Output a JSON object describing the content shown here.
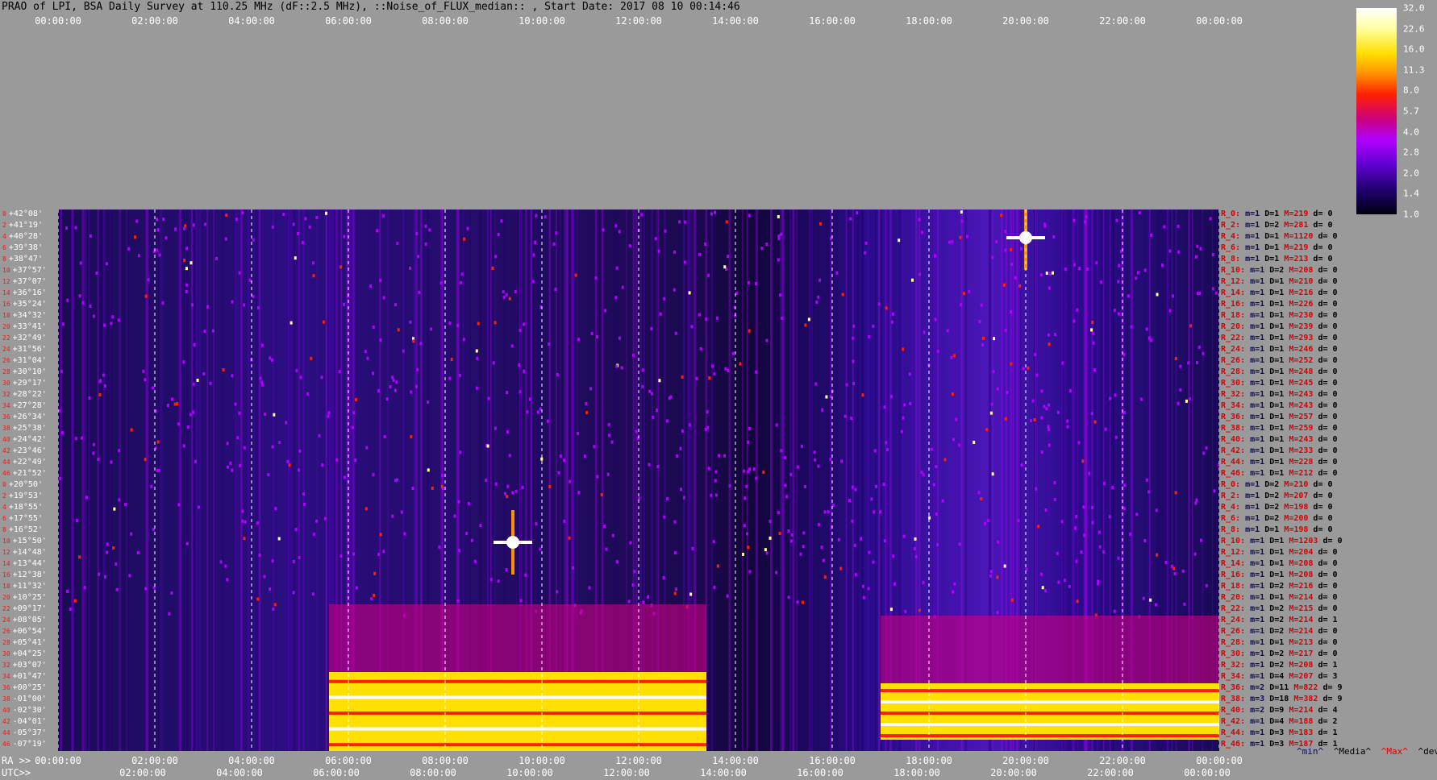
{
  "title": "PRAO of LPI, BSA Daily Survey at 110.25 MHz (dF::2.5 MHz), ::Noise_of_FLUX_median:: , Start Date: 2017 08 10 00:14:46",
  "chart_data": {
    "type": "heatmap",
    "x_axis_ticks_top": [
      "00:00:00",
      "02:00:00",
      "04:00:00",
      "06:00:00",
      "08:00:00",
      "10:00:00",
      "12:00:00",
      "14:00:00",
      "16:00:00",
      "18:00:00",
      "20:00:00",
      "22:00:00",
      "00:00:00"
    ],
    "x_axis_prefix_ra": "RA >>",
    "x_axis_ticks_bottom": [
      "00:00:00",
      "02:00:00",
      "04:00:00",
      "06:00:00",
      "08:00:00",
      "10:00:00",
      "12:00:00",
      "14:00:00",
      "16:00:00",
      "18:00:00",
      "20:00:00",
      "22:00:00",
      "00:00:00"
    ],
    "x_axis_prefix_utc": "UTC>>",
    "x_axis_ticks_utc": [
      "02:00:00",
      "04:00:00",
      "06:00:00",
      "08:00:00",
      "10:00:00",
      "12:00:00",
      "14:00:00",
      "16:00:00",
      "18:00:00",
      "20:00:00",
      "22:00:00",
      "00:00:00"
    ],
    "declinations": [
      "+42°08'",
      "+41°19'",
      "+40°28'",
      "+39°38'",
      "+38°47'",
      "+37°57'",
      "+37°07'",
      "+36°16'",
      "+35°24'",
      "+34°32'",
      "+33°41'",
      "+32°49'",
      "+31°56'",
      "+31°04'",
      "+30°10'",
      "+29°17'",
      "+28°22'",
      "+27°28'",
      "+26°34'",
      "+25°38'",
      "+24°42'",
      "+23°46'",
      "+22°49'",
      "+21°52'",
      "+20°50'",
      "+19°53'",
      "+18°55'",
      "+17°55'",
      "+16°52'",
      "+15°50'",
      "+14°48'",
      "+13°44'",
      "+12°38'",
      "+11°32'",
      "+10°25'",
      "+09°17'",
      "+08°05'",
      "+06°54'",
      "+05°41'",
      "+04°25'",
      "+03°07'",
      "+01°47'",
      "+00°25'",
      "-01°00'",
      "-02°30'",
      "-04°01'",
      "-05°37'",
      "-07°19'"
    ],
    "row_indices": [
      "0",
      "2",
      "4",
      "6",
      "8",
      "10",
      "12",
      "14",
      "16",
      "18",
      "20",
      "22",
      "24",
      "26",
      "28",
      "30",
      "32",
      "34",
      "36",
      "38",
      "40",
      "42",
      "44",
      "46",
      "0",
      "2",
      "4",
      "6",
      "8",
      "10",
      "12",
      "14",
      "16",
      "18",
      "20",
      "22",
      "24",
      "26",
      "28",
      "30",
      "32",
      "34",
      "36",
      "38",
      "40",
      "42",
      "44",
      "46"
    ],
    "row_stats": [
      {
        "r": "R_0:",
        "m": "m=1",
        "d": "D=1",
        "mx": "M=219",
        "dv": "d= 0"
      },
      {
        "r": "R_2:",
        "m": "m=1",
        "d": "D=2",
        "mx": "M=281",
        "dv": "d= 0"
      },
      {
        "r": "R_4:",
        "m": "m=1",
        "d": "D=1",
        "mx": "M=1120",
        "dv": "d= 0"
      },
      {
        "r": "R_6:",
        "m": "m=1",
        "d": "D=1",
        "mx": "M=219",
        "dv": "d= 0"
      },
      {
        "r": "R_8:",
        "m": "m=1",
        "d": "D=1",
        "mx": "M=213",
        "dv": "d= 0"
      },
      {
        "r": "R_10:",
        "m": "m=1",
        "d": "D=2",
        "mx": "M=208",
        "dv": "d= 0"
      },
      {
        "r": "R_12:",
        "m": "m=1",
        "d": "D=1",
        "mx": "M=210",
        "dv": "d= 0"
      },
      {
        "r": "R_14:",
        "m": "m=1",
        "d": "D=1",
        "mx": "M=216",
        "dv": "d= 0"
      },
      {
        "r": "R_16:",
        "m": "m=1",
        "d": "D=1",
        "mx": "M=226",
        "dv": "d= 0"
      },
      {
        "r": "R_18:",
        "m": "m=1",
        "d": "D=1",
        "mx": "M=230",
        "dv": "d= 0"
      },
      {
        "r": "R_20:",
        "m": "m=1",
        "d": "D=1",
        "mx": "M=239",
        "dv": "d= 0"
      },
      {
        "r": "R_22:",
        "m": "m=1",
        "d": "D=1",
        "mx": "M=293",
        "dv": "d= 0"
      },
      {
        "r": "R_24:",
        "m": "m=1",
        "d": "D=1",
        "mx": "M=246",
        "dv": "d= 0"
      },
      {
        "r": "R_26:",
        "m": "m=1",
        "d": "D=1",
        "mx": "M=252",
        "dv": "d= 0"
      },
      {
        "r": "R_28:",
        "m": "m=1",
        "d": "D=1",
        "mx": "M=248",
        "dv": "d= 0"
      },
      {
        "r": "R_30:",
        "m": "m=1",
        "d": "D=1",
        "mx": "M=245",
        "dv": "d= 0"
      },
      {
        "r": "R_32:",
        "m": "m=1",
        "d": "D=1",
        "mx": "M=243",
        "dv": "d= 0"
      },
      {
        "r": "R_34:",
        "m": "m=1",
        "d": "D=1",
        "mx": "M=243",
        "dv": "d= 0"
      },
      {
        "r": "R_36:",
        "m": "m=1",
        "d": "D=1",
        "mx": "M=257",
        "dv": "d= 0"
      },
      {
        "r": "R_38:",
        "m": "m=1",
        "d": "D=1",
        "mx": "M=259",
        "dv": "d= 0"
      },
      {
        "r": "R_40:",
        "m": "m=1",
        "d": "D=1",
        "mx": "M=243",
        "dv": "d= 0"
      },
      {
        "r": "R_42:",
        "m": "m=1",
        "d": "D=1",
        "mx": "M=233",
        "dv": "d= 0"
      },
      {
        "r": "R_44:",
        "m": "m=1",
        "d": "D=1",
        "mx": "M=228",
        "dv": "d= 0"
      },
      {
        "r": "R_46:",
        "m": "m=1",
        "d": "D=1",
        "mx": "M=212",
        "dv": "d= 0"
      },
      {
        "r": "R_0:",
        "m": "m=1",
        "d": "D=2",
        "mx": "M=210",
        "dv": "d= 0"
      },
      {
        "r": "R_2:",
        "m": "m=1",
        "d": "D=2",
        "mx": "M=207",
        "dv": "d= 0"
      },
      {
        "r": "R_4:",
        "m": "m=1",
        "d": "D=2",
        "mx": "M=198",
        "dv": "d= 0"
      },
      {
        "r": "R_6:",
        "m": "m=1",
        "d": "D=2",
        "mx": "M=200",
        "dv": "d= 0"
      },
      {
        "r": "R_8:",
        "m": "m=1",
        "d": "D=1",
        "mx": "M=198",
        "dv": "d= 0"
      },
      {
        "r": "R_10:",
        "m": "m=1",
        "d": "D=1",
        "mx": "M=1203",
        "dv": "d= 0"
      },
      {
        "r": "R_12:",
        "m": "m=1",
        "d": "D=1",
        "mx": "M=204",
        "dv": "d= 0"
      },
      {
        "r": "R_14:",
        "m": "m=1",
        "d": "D=1",
        "mx": "M=208",
        "dv": "d= 0"
      },
      {
        "r": "R_16:",
        "m": "m=1",
        "d": "D=1",
        "mx": "M=208",
        "dv": "d= 0"
      },
      {
        "r": "R_18:",
        "m": "m=1",
        "d": "D=2",
        "mx": "M=216",
        "dv": "d= 0"
      },
      {
        "r": "R_20:",
        "m": "m=1",
        "d": "D=1",
        "mx": "M=214",
        "dv": "d= 0"
      },
      {
        "r": "R_22:",
        "m": "m=1",
        "d": "D=2",
        "mx": "M=215",
        "dv": "d= 0"
      },
      {
        "r": "R_24:",
        "m": "m=1",
        "d": "D=2",
        "mx": "M=214",
        "dv": "d= 1"
      },
      {
        "r": "R_26:",
        "m": "m=1",
        "d": "D=2",
        "mx": "M=214",
        "dv": "d= 0"
      },
      {
        "r": "R_28:",
        "m": "m=1",
        "d": "D=1",
        "mx": "M=213",
        "dv": "d= 0"
      },
      {
        "r": "R_30:",
        "m": "m=1",
        "d": "D=2",
        "mx": "M=217",
        "dv": "d= 0"
      },
      {
        "r": "R_32:",
        "m": "m=1",
        "d": "D=2",
        "mx": "M=208",
        "dv": "d= 1"
      },
      {
        "r": "R_34:",
        "m": "m=1",
        "d": "D=4",
        "mx": "M=207",
        "dv": "d= 3"
      },
      {
        "r": "R_36:",
        "m": "m=2",
        "d": "D=11",
        "mx": "M=822",
        "dv": "d= 9"
      },
      {
        "r": "R_38:",
        "m": "m=3",
        "d": "D=18",
        "mx": "M=382",
        "dv": "d= 9"
      },
      {
        "r": "R_40:",
        "m": "m=2",
        "d": "D=9",
        "mx": "M=214",
        "dv": "d= 4"
      },
      {
        "r": "R_42:",
        "m": "m=1",
        "d": "D=4",
        "mx": "M=188",
        "dv": "d= 2"
      },
      {
        "r": "R_44:",
        "m": "m=1",
        "d": "D=3",
        "mx": "M=183",
        "dv": "d= 1"
      },
      {
        "r": "R_46:",
        "m": "m=1",
        "d": "D=3",
        "mx": "M=187",
        "dv": "d= 1"
      }
    ],
    "stat_legend": [
      "^min^",
      "^Media^",
      "^Max^",
      "^devia^"
    ],
    "colorbar_ticks": [
      "32.0",
      "22.6",
      "16.0",
      "11.3",
      "8.0",
      "5.7",
      "4.0",
      "2.8",
      "2.0",
      "1.4",
      "1.0"
    ],
    "colorbar_range": [
      1.0,
      32.0
    ],
    "colorbar_scale": "log",
    "colormap": [
      "#000010",
      "#200070",
      "#6000d0",
      "#b000ff",
      "#cc0080",
      "#ff2000",
      "#ff9000",
      "#ffe000",
      "#ffffa0",
      "#ffffff"
    ],
    "highlights": [
      {
        "hour": 5.6,
        "hour_end": 13.4,
        "dec_from": "+01°47'",
        "dec_to": "-07°19'",
        "level": "saturated"
      },
      {
        "hour": 17.0,
        "hour_end": 24.0,
        "dec_from": "+00°25'",
        "dec_to": "-05°37'",
        "level": "saturated"
      },
      {
        "hour": 20.0,
        "dec": "+40°28'",
        "level": "point-source"
      },
      {
        "hour": 9.4,
        "dec": "+15°50'",
        "level": "point-source"
      }
    ]
  }
}
